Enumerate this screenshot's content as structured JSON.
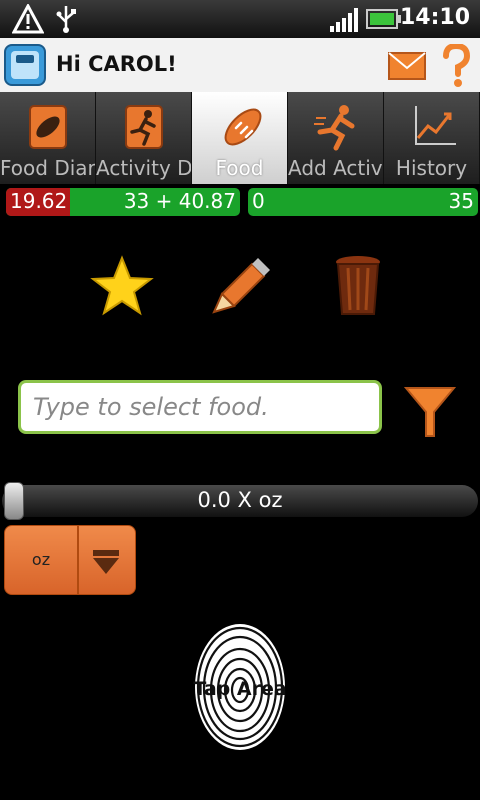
{
  "status_bar": {
    "time": "14:10"
  },
  "header": {
    "title": "Hi CAROL!"
  },
  "tabs": [
    {
      "label": "Food Diary",
      "icon": "bread-scroll-icon",
      "selected": false
    },
    {
      "label": "Activity Diary",
      "icon": "runner-scroll-icon",
      "selected": false
    },
    {
      "label": "Food",
      "icon": "bread-icon",
      "selected": true
    },
    {
      "label": "Add Activity",
      "icon": "runner-icon",
      "selected": false
    },
    {
      "label": "History",
      "icon": "chart-icon",
      "selected": false
    }
  ],
  "progress": {
    "left": {
      "value": "19.62",
      "summary": "33 + 40.87"
    },
    "right": {
      "start": "0",
      "end": "35"
    }
  },
  "actions": [
    "star-icon",
    "pencil-icon",
    "trash-icon"
  ],
  "search": {
    "placeholder": "Type to select food.",
    "value": ""
  },
  "slider": {
    "value": "0.0 X oz"
  },
  "unit": {
    "value": "oz"
  },
  "tap_area": {
    "label": "Tap Area"
  },
  "colors": {
    "accent": "#e8772e",
    "green": "#1aa32a",
    "red": "#b01818",
    "input_border": "#8bc34a"
  }
}
